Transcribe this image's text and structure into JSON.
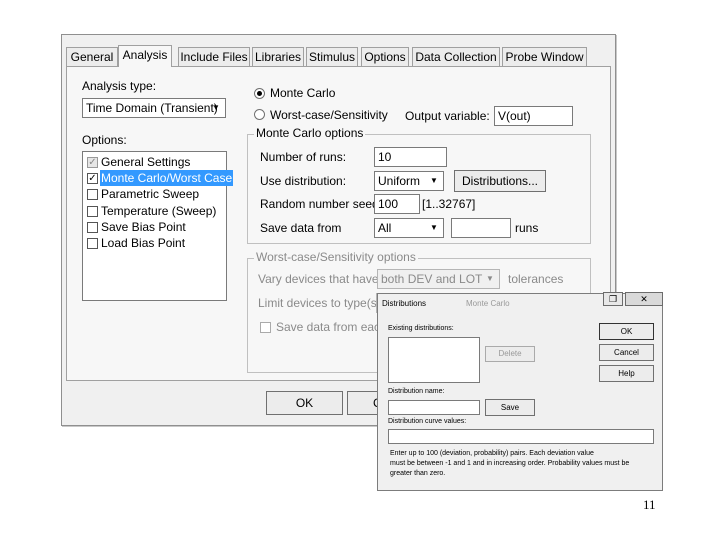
{
  "main_dialog": {
    "tabs": [
      "General",
      "Analysis",
      "Include Files",
      "Libraries",
      "Stimulus",
      "Options",
      "Data Collection",
      "Probe Window"
    ],
    "active_tab": "Analysis",
    "analysis_type_label": "Analysis type:",
    "analysis_type_value": "Time Domain (Transient)",
    "options_label": "Options:",
    "options_list": [
      {
        "label": "General Settings",
        "checked": true,
        "grayed": true,
        "selected": false
      },
      {
        "label": "Monte Carlo/Worst Case",
        "checked": true,
        "grayed": false,
        "selected": true
      },
      {
        "label": "Parametric Sweep",
        "checked": false,
        "grayed": false,
        "selected": false
      },
      {
        "label": "Temperature (Sweep)",
        "checked": false,
        "grayed": false,
        "selected": false
      },
      {
        "label": "Save Bias Point",
        "checked": false,
        "grayed": false,
        "selected": false
      },
      {
        "label": "Load Bias Point",
        "checked": false,
        "grayed": false,
        "selected": false
      }
    ],
    "radio_monte_carlo": "Monte Carlo",
    "radio_worst_case": "Worst-case/Sensitivity",
    "output_variable_label": "Output variable:",
    "output_variable_value": "V(out)",
    "mc_group_title": "Monte Carlo options",
    "num_runs_label": "Number of runs:",
    "num_runs_value": "10",
    "use_distribution_label": "Use distribution:",
    "use_distribution_value": "Uniform",
    "distributions_button": "Distributions...",
    "seed_label": "Random number seed:",
    "seed_value": "100",
    "seed_range": "[1..32767]",
    "save_data_label": "Save data from",
    "save_data_value": "All",
    "runs_label": "runs",
    "wc_group_title": "Worst-case/Sensitivity options",
    "vary_devices_label": "Vary devices that have",
    "vary_devices_value": "both DEV and LOT",
    "tolerances_label": "tolerances",
    "limit_devices_label": "Limit devices to type(s):",
    "save_each_label": "Save data from each",
    "ok_button": "OK",
    "cancel_button_fragment": "C"
  },
  "distributions_dialog": {
    "title": "Distributions",
    "title_faded": "Monte Carlo",
    "existing_label": "Existing distributions:",
    "delete_button": "Delete",
    "ok_button": "OK",
    "cancel_button": "Cancel",
    "help_button": "Help",
    "name_label": "Distribution name:",
    "save_button": "Save",
    "curve_label": "Distribution curve values:",
    "instructions": [
      "Enter up to 100 (deviation, probability) pairs.  Each deviation value",
      "must be between -1 and 1 and in increasing order.  Probability values must be",
      "greater than zero."
    ]
  },
  "page_number": "11"
}
